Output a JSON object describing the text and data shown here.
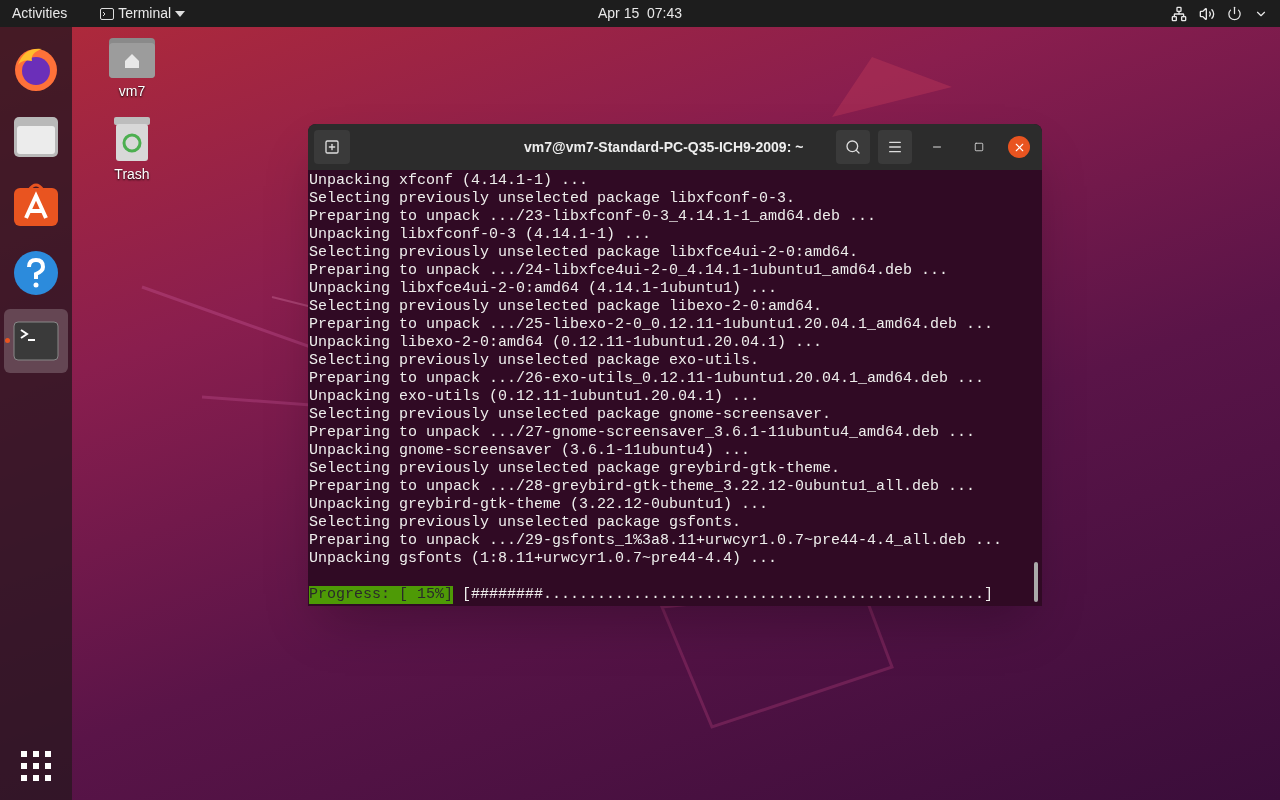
{
  "top_bar": {
    "activities": "Activities",
    "app_menu": "Terminal",
    "clock": "Apr 15  07:43"
  },
  "dock": {
    "apps": [
      {
        "kind": "firefox",
        "running": false
      },
      {
        "kind": "files",
        "running": false
      },
      {
        "kind": "software",
        "running": false
      },
      {
        "kind": "help",
        "running": false
      },
      {
        "kind": "terminal",
        "running": true
      }
    ]
  },
  "desktop_icons": [
    {
      "kind": "home",
      "label": "vm7"
    },
    {
      "kind": "trash",
      "label": "Trash"
    }
  ],
  "terminal": {
    "title": "vm7@vm7-Standard-PC-Q35-ICH9-2009: ~",
    "lines": [
      "Unpacking xfconf (4.14.1-1) ...",
      "Selecting previously unselected package libxfconf-0-3.",
      "Preparing to unpack .../23-libxfconf-0-3_4.14.1-1_amd64.deb ...",
      "Unpacking libxfconf-0-3 (4.14.1-1) ...",
      "Selecting previously unselected package libxfce4ui-2-0:amd64.",
      "Preparing to unpack .../24-libxfce4ui-2-0_4.14.1-1ubuntu1_amd64.deb ...",
      "Unpacking libxfce4ui-2-0:amd64 (4.14.1-1ubuntu1) ...",
      "Selecting previously unselected package libexo-2-0:amd64.",
      "Preparing to unpack .../25-libexo-2-0_0.12.11-1ubuntu1.20.04.1_amd64.deb ...",
      "Unpacking libexo-2-0:amd64 (0.12.11-1ubuntu1.20.04.1) ...",
      "Selecting previously unselected package exo-utils.",
      "Preparing to unpack .../26-exo-utils_0.12.11-1ubuntu1.20.04.1_amd64.deb ...",
      "Unpacking exo-utils (0.12.11-1ubuntu1.20.04.1) ...",
      "Selecting previously unselected package gnome-screensaver.",
      "Preparing to unpack .../27-gnome-screensaver_3.6.1-11ubuntu4_amd64.deb ...",
      "Unpacking gnome-screensaver (3.6.1-11ubuntu4) ...",
      "Selecting previously unselected package greybird-gtk-theme.",
      "Preparing to unpack .../28-greybird-gtk-theme_3.22.12-0ubuntu1_all.deb ...",
      "Unpacking greybird-gtk-theme (3.22.12-0ubuntu1) ...",
      "Selecting previously unselected package gsfonts.",
      "Preparing to unpack .../29-gsfonts_1%3a8.11+urwcyr1.0.7~pre44-4.4_all.deb ...",
      "Unpacking gsfonts (1:8.11+urwcyr1.0.7~pre44-4.4) ..."
    ],
    "progress": {
      "label": "Progress: [ 15%]",
      "bar": "[########.................................................]"
    }
  }
}
